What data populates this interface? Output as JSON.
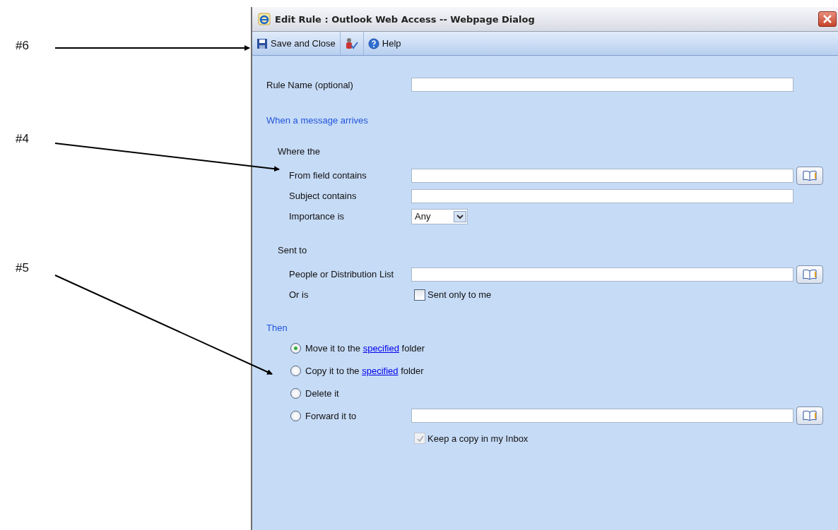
{
  "annotations": [
    {
      "label": "#6"
    },
    {
      "label": "#4"
    },
    {
      "label": "#5"
    }
  ],
  "window": {
    "title": "Edit Rule : Outlook Web Access -- Webpage Dialog"
  },
  "toolbar": [
    {
      "kind": "save",
      "label": "Save and Close"
    },
    {
      "kind": "check-names"
    },
    {
      "kind": "help",
      "label": "Help"
    }
  ],
  "rule_name": {
    "label": "Rule Name  (optional)"
  },
  "when_heading": "When a message arrives",
  "where": {
    "heading": "Where the",
    "rows": [
      {
        "kind": "text",
        "label": "From field contains",
        "address_book": true
      },
      {
        "kind": "text",
        "label": "Subject contains",
        "address_book": false
      },
      {
        "kind": "select",
        "label": "Importance is",
        "value": "Any"
      }
    ]
  },
  "sent_to": {
    "heading": "Sent to",
    "rows": [
      {
        "kind": "text",
        "label": "People or Distribution List",
        "address_book": true
      },
      {
        "kind": "checkbox",
        "label": "Or is",
        "option": "Sent only to me",
        "checked": false
      }
    ]
  },
  "then": {
    "heading": "Then",
    "actions": [
      {
        "kind": "link",
        "text": "Move it to the ",
        "link": "specified",
        "after": " folder",
        "selected": true
      },
      {
        "kind": "link",
        "text": "Copy it to the ",
        "link": "specified",
        "after": " folder",
        "selected": false
      },
      {
        "kind": "plain",
        "text": "Delete it",
        "selected": false
      },
      {
        "kind": "field",
        "text": "Forward it to",
        "selected": false,
        "address_book": true
      }
    ],
    "keep_copy": {
      "label": "Keep a copy in my Inbox",
      "checked": true,
      "disabled": true
    }
  }
}
